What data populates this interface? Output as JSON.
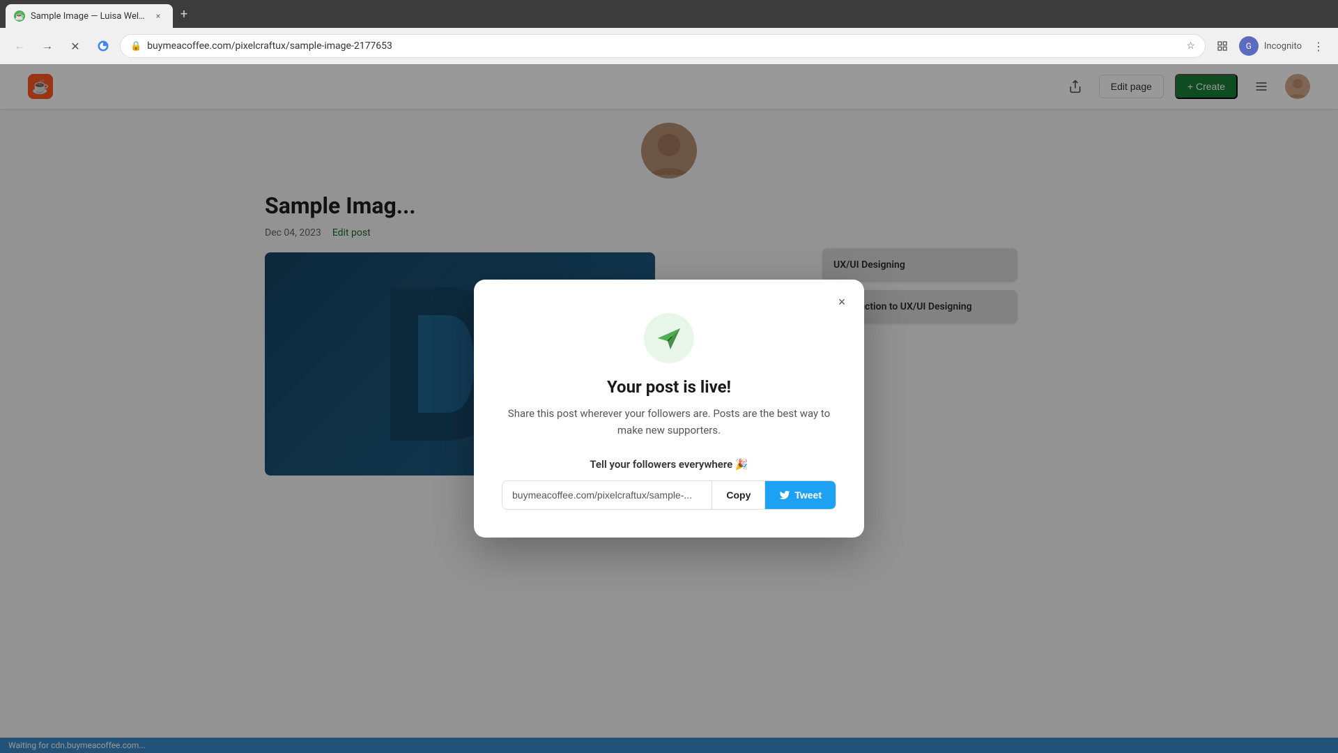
{
  "browser": {
    "tab": {
      "title": "Sample Image — Luisa Welch",
      "favicon": "☕"
    },
    "address": "buymeacoffee.com/pixelcraftux/sample-image-2177653",
    "new_tab_label": "+",
    "incognito_label": "Incognito"
  },
  "header": {
    "logo_icon": "☕",
    "share_icon": "↑",
    "edit_page_label": "Edit page",
    "create_label": "+ Create",
    "hamburger_icon": "≡"
  },
  "page": {
    "post_title": "Sample Imag...",
    "post_date": "Dec 04, 2023",
    "edit_post_label": "Edit post",
    "sidebar_item1": "UX/UI Designing",
    "sidebar_item2": "Introduction to UX/UI Designing"
  },
  "modal": {
    "close_label": "×",
    "title": "Your post is live!",
    "subtitle": "Share this post wherever your followers are. Posts are the best way to make new supporters.",
    "section_title": "Tell your followers everywhere 🎉",
    "url_value": "buymeacoffee.com/pixelcraftux/sample-...",
    "copy_label": "Copy",
    "tweet_label": "Tweet",
    "tweet_icon": "🐦"
  },
  "status_bar": {
    "text": "Waiting for cdn.buymeacoffee.com..."
  }
}
